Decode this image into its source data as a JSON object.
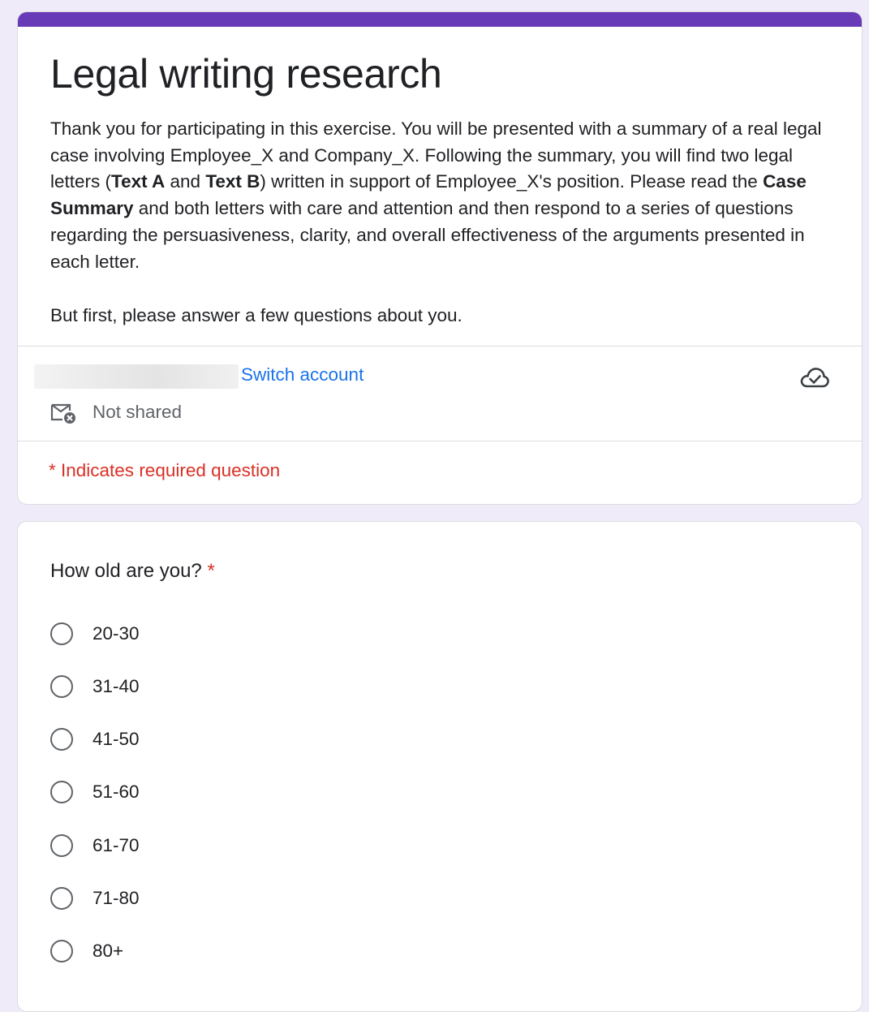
{
  "header": {
    "title": "Legal writing research",
    "intro": {
      "p1_a": "Thank you for participating in this exercise. You will be presented with a summary of a real legal case involving Employee_X and Company_X. Following the summary, you will find two legal letters (",
      "text_a": "Text A",
      "p1_b": " and ",
      "text_b": "Text B",
      "p1_c": ") written in support of Employee_X's position. Please read the ",
      "case_summary": "Case Summary",
      "p1_d": " and both letters with care and attention and then respond to a series of questions regarding the persuasiveness, clarity, and overall effectiveness of the arguments presented in each letter.",
      "p2": "But first, please answer a few questions about you."
    },
    "accent_color": "#673ab7"
  },
  "account": {
    "switch_label": "Switch account",
    "not_shared_label": "Not shared",
    "cloud_icon": "cloud-check-icon",
    "mail_icon": "mail-off-icon"
  },
  "required_note": "* Indicates required question",
  "question": {
    "title": "How old are you?",
    "required_mark": "*",
    "options": [
      "20-30",
      "31-40",
      "41-50",
      "51-60",
      "61-70",
      "71-80",
      "80+"
    ]
  }
}
